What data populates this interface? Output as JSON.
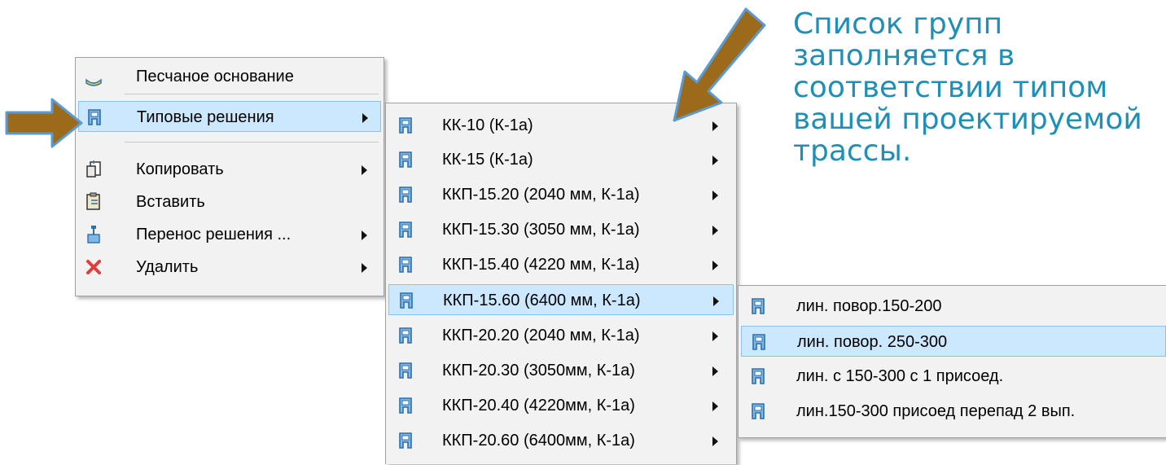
{
  "context_menu": {
    "items": [
      {
        "label": "Песчаное основание",
        "icon": "sand-layer-icon",
        "has_submenu": false
      },
      {
        "label": "Типовые решения",
        "icon": "well-template-icon",
        "has_submenu": true
      },
      {
        "label": "Копировать",
        "icon": "copy-icon",
        "has_submenu": true
      },
      {
        "label": "Вставить",
        "icon": "paste-icon",
        "has_submenu": false
      },
      {
        "label": "Перенос решения ...",
        "icon": "transfer-solution-icon",
        "has_submenu": true
      },
      {
        "label": "Удалить",
        "icon": "delete-x-icon",
        "has_submenu": true
      }
    ]
  },
  "submenu_groups": {
    "items": [
      {
        "label": "КК-10  (К-1а)",
        "icon": "well-template-icon"
      },
      {
        "label": "КК-15  (К-1а)",
        "icon": "well-template-icon"
      },
      {
        "label": "ККП-15.20 (2040 мм, К-1а)",
        "icon": "well-template-icon"
      },
      {
        "label": "ККП-15.30 (3050 мм, К-1а)",
        "icon": "well-template-icon"
      },
      {
        "label": "ККП-15.40 (4220 мм, К-1а)",
        "icon": "well-template-icon"
      },
      {
        "label": "ККП-15.60 (6400 мм, К-1а)",
        "icon": "well-template-icon"
      },
      {
        "label": "ККП-20.20 (2040 мм, К-1а)",
        "icon": "well-template-icon"
      },
      {
        "label": "ККП-20.30 (3050мм, К-1а)",
        "icon": "well-template-icon"
      },
      {
        "label": "ККП-20.40 (4220мм, К-1а)",
        "icon": "well-template-icon"
      },
      {
        "label": "ККП-20.60 (6400мм, К-1а)",
        "icon": "well-template-icon"
      }
    ]
  },
  "submenu_solutions": {
    "items": [
      {
        "label": "лин. повор.150-200",
        "icon": "well-template-icon"
      },
      {
        "label": "лин. повор. 250-300",
        "icon": "well-template-icon"
      },
      {
        "label": "лин. с 150-300 с 1 присоед.",
        "icon": "well-template-icon"
      },
      {
        "label": "лин.150-300 присоед перепад 2 вып.",
        "icon": "well-template-icon"
      }
    ]
  },
  "annotation": {
    "lines": [
      "Список групп",
      "заполняется в",
      "соответствии типом",
      "вашей проектируемой",
      "трассы."
    ]
  },
  "colors": {
    "menu_bg": "#f2f2f2",
    "highlight": "#cce8ff",
    "highlight_border": "#8fc1ee",
    "annotation_text": "#1f8fb8",
    "pointer_arrow_fill": "#9b6a1a",
    "pointer_arrow_outline": "#5b9bd5"
  },
  "state": {
    "selected_main": "Типовые решения",
    "selected_group": "ККП-15.60 (6400 мм, К-1а)",
    "selected_solution": "лин. повор. 250-300"
  }
}
